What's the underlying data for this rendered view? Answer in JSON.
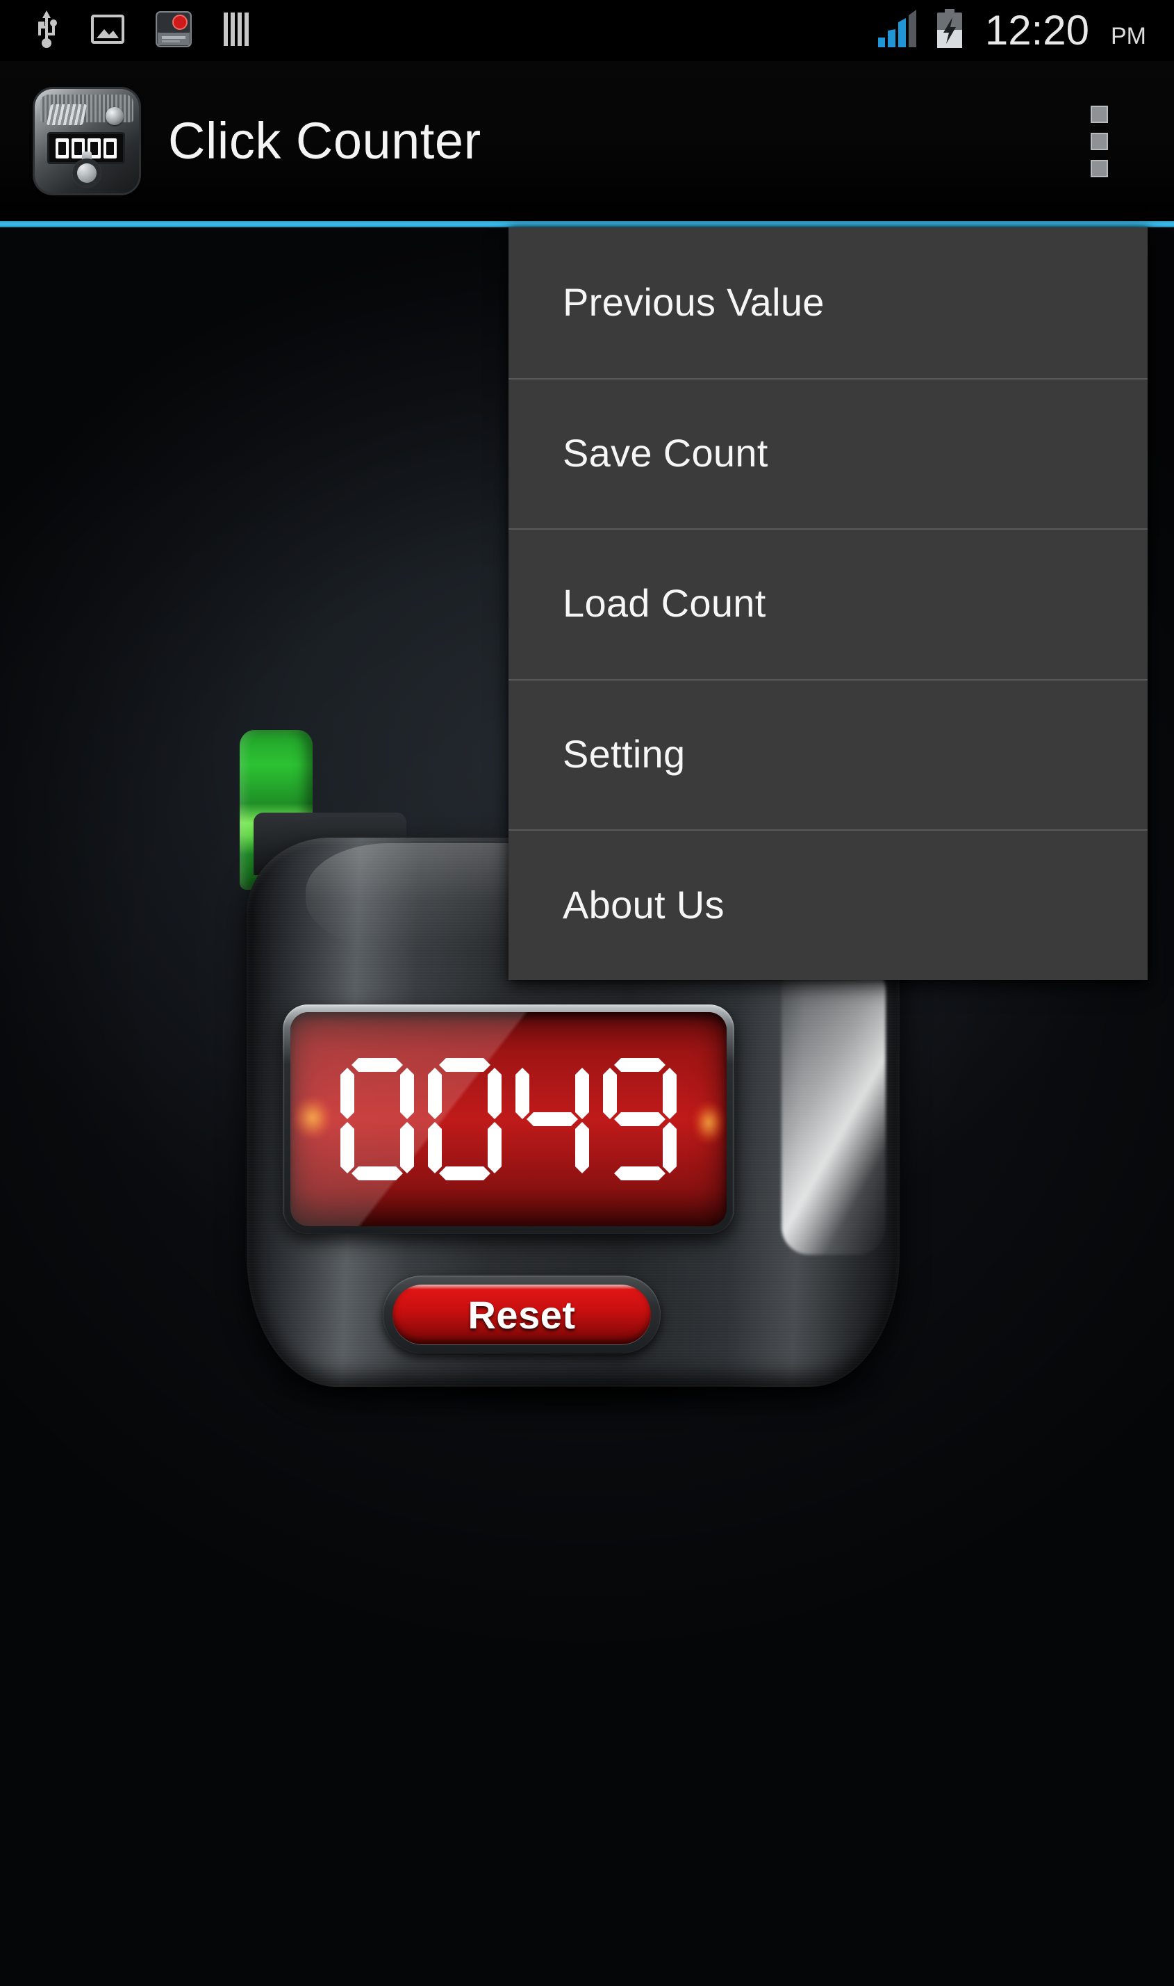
{
  "status_bar": {
    "icons_left": [
      {
        "name": "usb-icon",
        "label": "USB connected"
      },
      {
        "name": "screenshot-icon",
        "label": "Screenshot captured"
      },
      {
        "name": "screen-recorder-icon",
        "label": "Screen recorder"
      },
      {
        "name": "bars-icon",
        "label": "Notification bars"
      }
    ],
    "signal": {
      "name": "signal-bars-icon",
      "bars_active": 3,
      "bars_total": 4,
      "color": "#33a5dd"
    },
    "battery": {
      "name": "battery-charging-icon",
      "state": "charging"
    },
    "time": "12:20",
    "ampm": "PM"
  },
  "action_bar": {
    "app_icon": "click-counter-app-icon",
    "title": "Click Counter",
    "overflow_button": "overflow-menu-button",
    "accent_color": "#33b5e5"
  },
  "overflow_menu": {
    "items": [
      {
        "label": "Previous Value"
      },
      {
        "label": "Save Count"
      },
      {
        "label": "Load Count"
      },
      {
        "label": "Setting"
      },
      {
        "label": "About Us"
      }
    ],
    "background_color": "#3b3b3b",
    "text_color": "#f6f6f6",
    "divider_color": "#5a5a5a"
  },
  "counter": {
    "display_value": "0049",
    "digits": [
      "0",
      "0",
      "4",
      "9"
    ],
    "display_color": "#c01a1a",
    "digit_color": "#ffffff",
    "clicker_color": "#2cc233",
    "reset_button": {
      "label": "Reset",
      "color": "#c60f0f"
    }
  }
}
